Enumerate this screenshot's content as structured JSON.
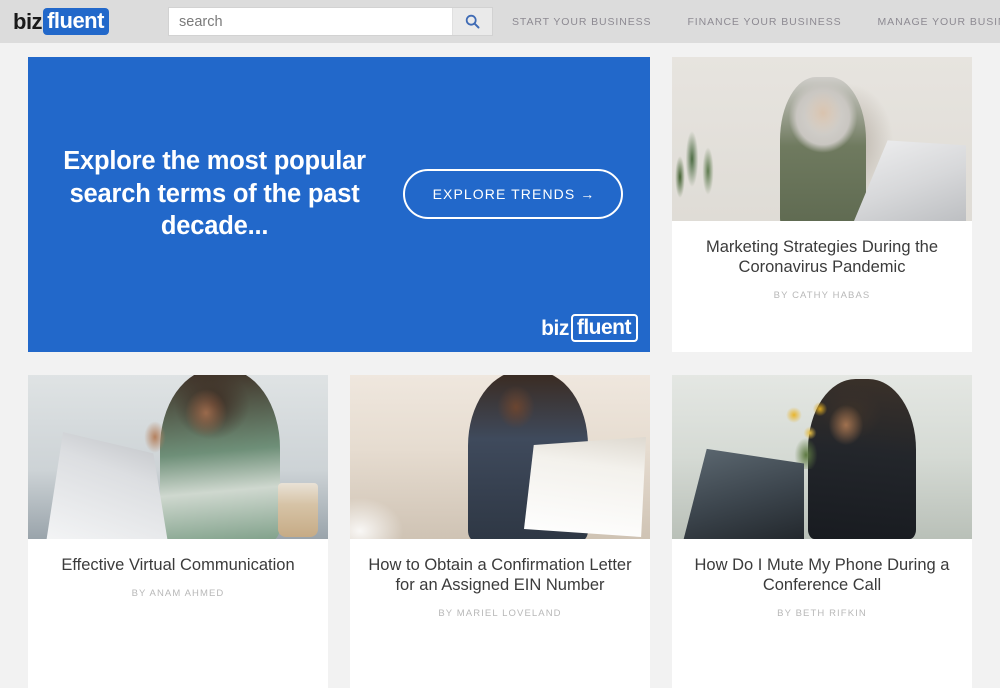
{
  "header": {
    "logo": {
      "part1": "biz",
      "part2": "fluent"
    },
    "search": {
      "placeholder": "search",
      "value": "",
      "icon": "search-icon"
    },
    "nav": [
      {
        "label": "START YOUR BUSINESS"
      },
      {
        "label": "FINANCE YOUR BUSINESS"
      },
      {
        "label": "MANAGE YOUR BUSINESS"
      }
    ]
  },
  "hero": {
    "title": "Explore the most popular search terms of the past decade...",
    "cta_label": "EXPLORE TRENDS →",
    "logo": {
      "part1": "biz",
      "part2": "fluent"
    },
    "background_color": "#2268ca"
  },
  "cards": [
    {
      "title": "Marketing Strategies During the Coronavirus Pandemic",
      "byline": "BY CATHY HABAS",
      "image_alt": "woman-with-gray-hair-writing-at-laptop"
    },
    {
      "title": "Effective Virtual Communication",
      "byline": "BY ANAM AHMED",
      "image_alt": "woman-waving-at-laptop-video-call"
    },
    {
      "title": "How to Obtain a Confirmation Letter for an Assigned EIN Number",
      "byline": "BY MARIEL LOVELAND",
      "image_alt": "man-on-phone-reading-document"
    },
    {
      "title": "How Do I Mute My Phone During a Conference Call",
      "byline": "BY BETH RIFKIN",
      "image_alt": "woman-at-laptop-with-sunflowers"
    }
  ],
  "colors": {
    "brand_blue": "#2268ca",
    "header_gray": "#dcdcdc",
    "page_bg": "#f2f2f2",
    "title_text": "#3b3b3b",
    "byline_text": "#b8b8b8"
  }
}
